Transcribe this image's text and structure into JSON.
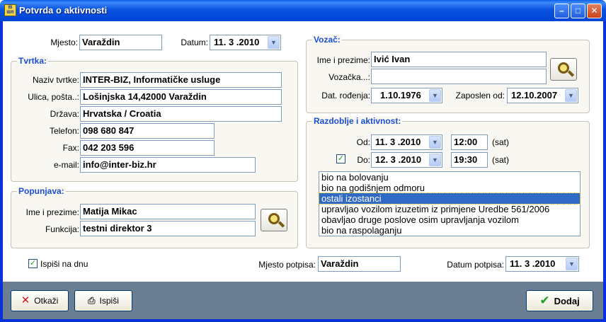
{
  "window": {
    "title": "Potvrda o aktivnosti",
    "icon_text": "IB IBR"
  },
  "top": {
    "mjesto_label": "Mjesto:",
    "mjesto_value": "Varaždin",
    "datum_label": "Datum:",
    "datum_value": "11. 3 .2010"
  },
  "tvrtka": {
    "title": "Tvrtka:",
    "naziv_label": "Naziv tvrtke:",
    "naziv_value": "INTER-BIZ, Informatičke usluge",
    "ulica_label": "Ulica, pošta..:",
    "ulica_value": "Lošinjska 14,42000 Varaždin",
    "drzava_label": "Država:",
    "drzava_value": "Hrvatska / Croatia",
    "telefon_label": "Telefon:",
    "telefon_value": "098 680 847",
    "fax_label": "Fax:",
    "fax_value": "042 203 596",
    "email_label": "e-mail:",
    "email_value": "info@inter-biz.hr"
  },
  "popunjava": {
    "title": "Popunjava:",
    "ime_label": "Ime i prezime:",
    "ime_value": "Matija Mikac",
    "funkcija_label": "Funkcija:",
    "funkcija_value": "testni direktor 3"
  },
  "vozac": {
    "title": "Vozač:",
    "ime_label": "Ime i prezime:",
    "ime_value": "Ivić Ivan",
    "vozacka_label": "Vozačka...:",
    "vozacka_value": "",
    "dat_rodjenja_label": "Dat. rođenja:",
    "dat_rodjenja_value": "1.10.1976",
    "zaposlen_label": "Zaposlen od:",
    "zaposlen_value": "12.10.2007"
  },
  "razdoblje": {
    "title": "Razdoblje i aktivnost:",
    "od_label": "Od:",
    "od_date": "11. 3 .2010",
    "od_time": "12:00",
    "do_label": "Do:",
    "do_date": "12. 3 .2010",
    "do_time": "19:30",
    "sat_label": "(sat)",
    "do_checked": true,
    "activities": [
      "bio na bolovanju",
      "bio na godišnjem odmoru",
      "ostali izostanci",
      "upravljao vozilom izuzetim iz primjene Uredbe 561/2006",
      "obavljao druge poslove osim upravljanja vozilom",
      "bio na raspolaganju"
    ],
    "selected_index": 2
  },
  "bottom": {
    "ispisi_na_dnu_label": "Ispiši na dnu",
    "ispisi_na_dnu_checked": true,
    "mjesto_potpisa_label": "Mjesto potpisa:",
    "mjesto_potpisa_value": "Varaždin",
    "datum_potpisa_label": "Datum potpisa:",
    "datum_potpisa_value": "11. 3 .2010"
  },
  "buttons": {
    "otkazi": "Otkaži",
    "ispisi": "Ispiši",
    "dodaj": "Dodaj"
  },
  "colors": {
    "titlebar": "#0a52e0",
    "group_title": "#1b4fd1",
    "footer": "#6c7f92",
    "selection": "#316ac5"
  }
}
